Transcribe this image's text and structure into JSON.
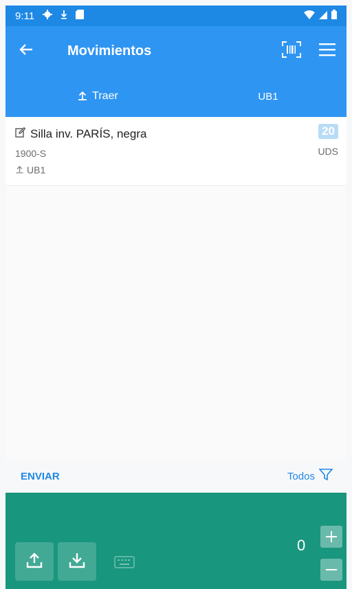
{
  "status_bar": {
    "time": "9:11",
    "icons": [
      "settings-icon",
      "download-icon",
      "sd-card-icon",
      "wifi-icon",
      "signal-icon",
      "battery-icon"
    ]
  },
  "app_bar": {
    "title": "Movimientos",
    "back_icon": "arrow-left-icon",
    "actions": [
      "barcode-scan-icon",
      "menu-icon"
    ]
  },
  "location_bar": {
    "from_label": "Traer",
    "from_icon": "pickup-icon",
    "to_label": "UB1"
  },
  "items": [
    {
      "name": "Silla inv. PARÍS, negra",
      "icon": "edit-icon",
      "code": "1900-S",
      "location": "UB1",
      "quantity": "20",
      "unit": "UDS"
    }
  ],
  "actions_row": {
    "send_label": "ENVIAR",
    "filter_label": "Todos",
    "filter_icon": "filter-icon"
  },
  "footer": {
    "count": "0",
    "buttons": [
      "upload-icon",
      "download-icon",
      "keyboard-icon"
    ],
    "stepper": [
      "plus-icon",
      "minus-icon"
    ]
  },
  "colors": {
    "app_bar": "#2f95f2",
    "status_bar": "#1e88e5",
    "footer": "#19967e",
    "accent": "#1e88e5",
    "badge": "#b8dcf6"
  }
}
